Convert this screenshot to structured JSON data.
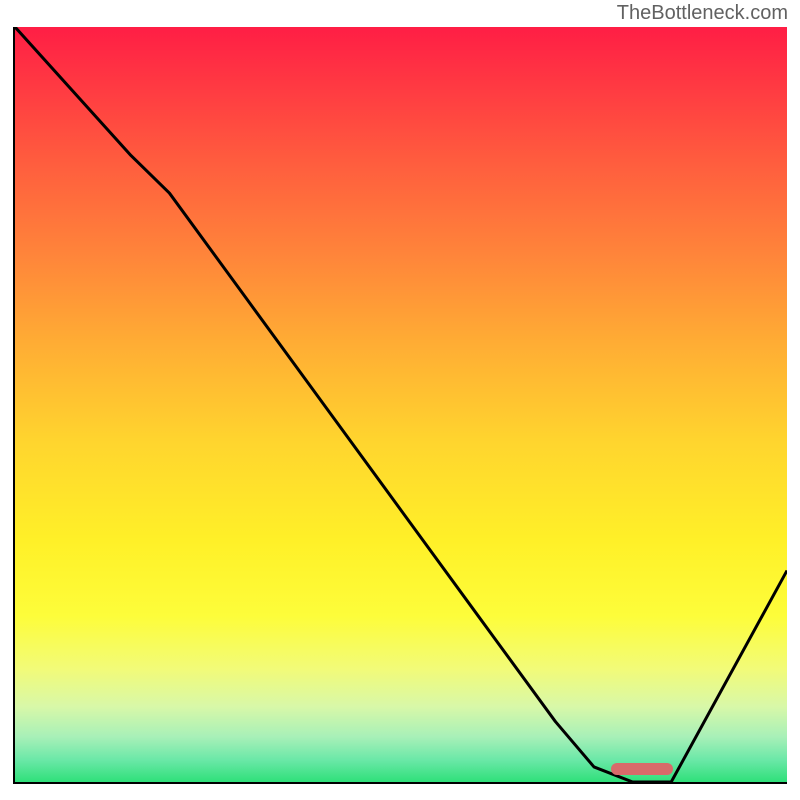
{
  "attribution": "TheBottleneck.com",
  "chart_data": {
    "type": "line",
    "title": "",
    "xlabel": "",
    "ylabel": "",
    "xlim": [
      0,
      100
    ],
    "ylim": [
      0,
      100
    ],
    "series": [
      {
        "name": "bottleneck-curve",
        "x": [
          0,
          15,
          20,
          30,
          40,
          50,
          60,
          70,
          75,
          80,
          85,
          100
        ],
        "y": [
          100,
          83,
          78,
          64,
          50,
          36,
          22,
          8,
          2,
          0,
          0,
          28
        ]
      }
    ],
    "optimal_marker": {
      "x_start": 77,
      "x_end": 85,
      "y": 2
    },
    "gradient_stops": [
      {
        "pct": 0,
        "color": "#ff1e45"
      },
      {
        "pct": 50,
        "color": "#ffd52e"
      },
      {
        "pct": 80,
        "color": "#fdfd3a"
      },
      {
        "pct": 100,
        "color": "#2fe07a"
      }
    ]
  }
}
